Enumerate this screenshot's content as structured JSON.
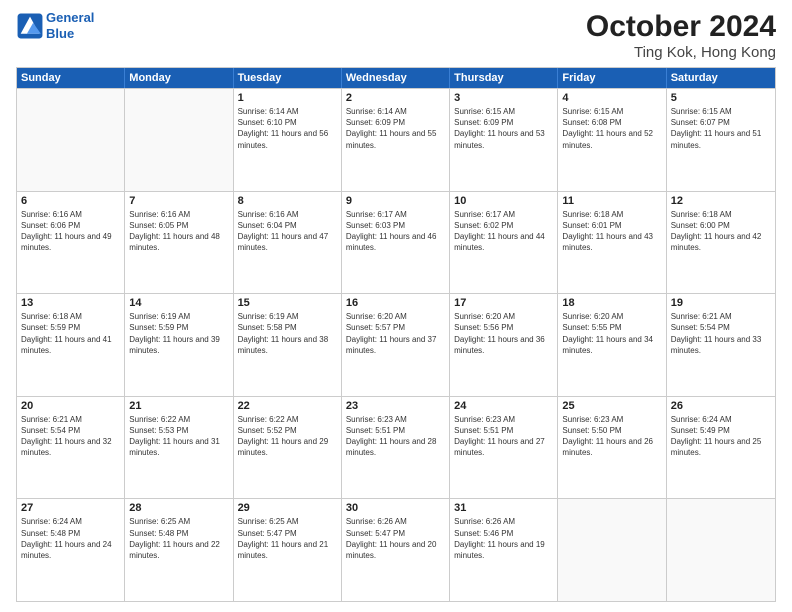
{
  "header": {
    "logo_line1": "General",
    "logo_line2": "Blue",
    "title": "October 2024",
    "subtitle": "Ting Kok, Hong Kong"
  },
  "weekdays": [
    "Sunday",
    "Monday",
    "Tuesday",
    "Wednesday",
    "Thursday",
    "Friday",
    "Saturday"
  ],
  "weeks": [
    [
      {
        "day": "",
        "sunrise": "",
        "sunset": "",
        "daylight": ""
      },
      {
        "day": "",
        "sunrise": "",
        "sunset": "",
        "daylight": ""
      },
      {
        "day": "1",
        "sunrise": "Sunrise: 6:14 AM",
        "sunset": "Sunset: 6:10 PM",
        "daylight": "Daylight: 11 hours and 56 minutes."
      },
      {
        "day": "2",
        "sunrise": "Sunrise: 6:14 AM",
        "sunset": "Sunset: 6:09 PM",
        "daylight": "Daylight: 11 hours and 55 minutes."
      },
      {
        "day": "3",
        "sunrise": "Sunrise: 6:15 AM",
        "sunset": "Sunset: 6:09 PM",
        "daylight": "Daylight: 11 hours and 53 minutes."
      },
      {
        "day": "4",
        "sunrise": "Sunrise: 6:15 AM",
        "sunset": "Sunset: 6:08 PM",
        "daylight": "Daylight: 11 hours and 52 minutes."
      },
      {
        "day": "5",
        "sunrise": "Sunrise: 6:15 AM",
        "sunset": "Sunset: 6:07 PM",
        "daylight": "Daylight: 11 hours and 51 minutes."
      }
    ],
    [
      {
        "day": "6",
        "sunrise": "Sunrise: 6:16 AM",
        "sunset": "Sunset: 6:06 PM",
        "daylight": "Daylight: 11 hours and 49 minutes."
      },
      {
        "day": "7",
        "sunrise": "Sunrise: 6:16 AM",
        "sunset": "Sunset: 6:05 PM",
        "daylight": "Daylight: 11 hours and 48 minutes."
      },
      {
        "day": "8",
        "sunrise": "Sunrise: 6:16 AM",
        "sunset": "Sunset: 6:04 PM",
        "daylight": "Daylight: 11 hours and 47 minutes."
      },
      {
        "day": "9",
        "sunrise": "Sunrise: 6:17 AM",
        "sunset": "Sunset: 6:03 PM",
        "daylight": "Daylight: 11 hours and 46 minutes."
      },
      {
        "day": "10",
        "sunrise": "Sunrise: 6:17 AM",
        "sunset": "Sunset: 6:02 PM",
        "daylight": "Daylight: 11 hours and 44 minutes."
      },
      {
        "day": "11",
        "sunrise": "Sunrise: 6:18 AM",
        "sunset": "Sunset: 6:01 PM",
        "daylight": "Daylight: 11 hours and 43 minutes."
      },
      {
        "day": "12",
        "sunrise": "Sunrise: 6:18 AM",
        "sunset": "Sunset: 6:00 PM",
        "daylight": "Daylight: 11 hours and 42 minutes."
      }
    ],
    [
      {
        "day": "13",
        "sunrise": "Sunrise: 6:18 AM",
        "sunset": "Sunset: 5:59 PM",
        "daylight": "Daylight: 11 hours and 41 minutes."
      },
      {
        "day": "14",
        "sunrise": "Sunrise: 6:19 AM",
        "sunset": "Sunset: 5:59 PM",
        "daylight": "Daylight: 11 hours and 39 minutes."
      },
      {
        "day": "15",
        "sunrise": "Sunrise: 6:19 AM",
        "sunset": "Sunset: 5:58 PM",
        "daylight": "Daylight: 11 hours and 38 minutes."
      },
      {
        "day": "16",
        "sunrise": "Sunrise: 6:20 AM",
        "sunset": "Sunset: 5:57 PM",
        "daylight": "Daylight: 11 hours and 37 minutes."
      },
      {
        "day": "17",
        "sunrise": "Sunrise: 6:20 AM",
        "sunset": "Sunset: 5:56 PM",
        "daylight": "Daylight: 11 hours and 36 minutes."
      },
      {
        "day": "18",
        "sunrise": "Sunrise: 6:20 AM",
        "sunset": "Sunset: 5:55 PM",
        "daylight": "Daylight: 11 hours and 34 minutes."
      },
      {
        "day": "19",
        "sunrise": "Sunrise: 6:21 AM",
        "sunset": "Sunset: 5:54 PM",
        "daylight": "Daylight: 11 hours and 33 minutes."
      }
    ],
    [
      {
        "day": "20",
        "sunrise": "Sunrise: 6:21 AM",
        "sunset": "Sunset: 5:54 PM",
        "daylight": "Daylight: 11 hours and 32 minutes."
      },
      {
        "day": "21",
        "sunrise": "Sunrise: 6:22 AM",
        "sunset": "Sunset: 5:53 PM",
        "daylight": "Daylight: 11 hours and 31 minutes."
      },
      {
        "day": "22",
        "sunrise": "Sunrise: 6:22 AM",
        "sunset": "Sunset: 5:52 PM",
        "daylight": "Daylight: 11 hours and 29 minutes."
      },
      {
        "day": "23",
        "sunrise": "Sunrise: 6:23 AM",
        "sunset": "Sunset: 5:51 PM",
        "daylight": "Daylight: 11 hours and 28 minutes."
      },
      {
        "day": "24",
        "sunrise": "Sunrise: 6:23 AM",
        "sunset": "Sunset: 5:51 PM",
        "daylight": "Daylight: 11 hours and 27 minutes."
      },
      {
        "day": "25",
        "sunrise": "Sunrise: 6:23 AM",
        "sunset": "Sunset: 5:50 PM",
        "daylight": "Daylight: 11 hours and 26 minutes."
      },
      {
        "day": "26",
        "sunrise": "Sunrise: 6:24 AM",
        "sunset": "Sunset: 5:49 PM",
        "daylight": "Daylight: 11 hours and 25 minutes."
      }
    ],
    [
      {
        "day": "27",
        "sunrise": "Sunrise: 6:24 AM",
        "sunset": "Sunset: 5:48 PM",
        "daylight": "Daylight: 11 hours and 24 minutes."
      },
      {
        "day": "28",
        "sunrise": "Sunrise: 6:25 AM",
        "sunset": "Sunset: 5:48 PM",
        "daylight": "Daylight: 11 hours and 22 minutes."
      },
      {
        "day": "29",
        "sunrise": "Sunrise: 6:25 AM",
        "sunset": "Sunset: 5:47 PM",
        "daylight": "Daylight: 11 hours and 21 minutes."
      },
      {
        "day": "30",
        "sunrise": "Sunrise: 6:26 AM",
        "sunset": "Sunset: 5:47 PM",
        "daylight": "Daylight: 11 hours and 20 minutes."
      },
      {
        "day": "31",
        "sunrise": "Sunrise: 6:26 AM",
        "sunset": "Sunset: 5:46 PM",
        "daylight": "Daylight: 11 hours and 19 minutes."
      },
      {
        "day": "",
        "sunrise": "",
        "sunset": "",
        "daylight": ""
      },
      {
        "day": "",
        "sunrise": "",
        "sunset": "",
        "daylight": ""
      }
    ]
  ]
}
